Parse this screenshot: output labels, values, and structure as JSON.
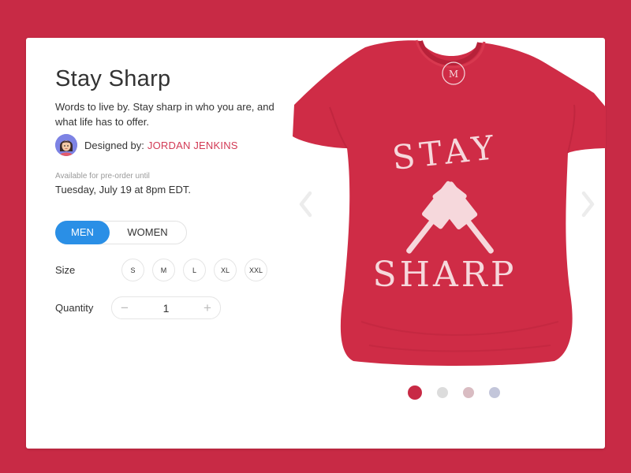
{
  "product": {
    "title": "Stay Sharp",
    "description": "Words to live by. Stay sharp in who you are, and what life has to offer.",
    "designer_label": "Designed by:",
    "designer_name": "JORDAN JENKINS",
    "availability_label": "Available for pre-order until",
    "availability_date": "Tuesday, July 19 at 8pm EDT."
  },
  "gender": {
    "options": [
      "MEN",
      "WOMEN"
    ],
    "selected": "MEN"
  },
  "size": {
    "label": "Size",
    "options": [
      "S",
      "M",
      "L",
      "XL",
      "XXL"
    ]
  },
  "quantity": {
    "label": "Quantity",
    "minus": "−",
    "plus": "+",
    "value": "1"
  },
  "shirt_print": {
    "line1": "STAY",
    "line2": "SHARP",
    "collar_logo": "M"
  },
  "carousel": {
    "dots": [
      "#c82a45",
      "#dcdcdc",
      "#d9bcc2",
      "#c3c6da"
    ],
    "selected_index": 0,
    "left_icon": "chevron-left-icon",
    "right_icon": "chevron-right-icon"
  },
  "colors": {
    "background": "#c82a45",
    "accent": "#2a8fe6",
    "designer_link": "#d23a55",
    "shirt": "#cf2c46"
  }
}
